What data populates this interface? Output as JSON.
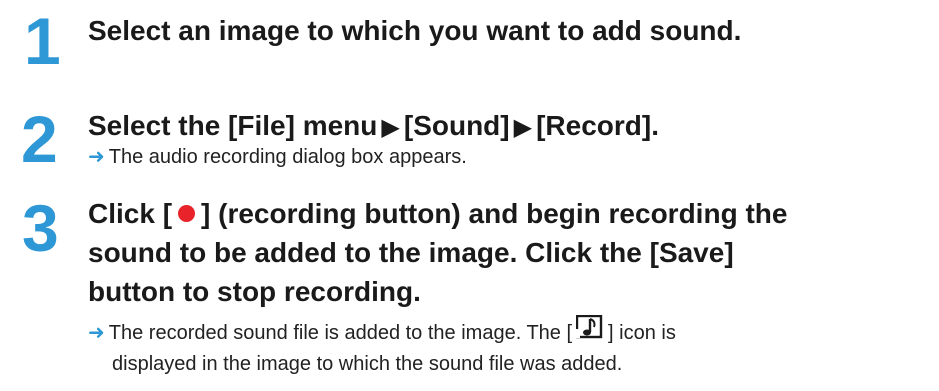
{
  "steps": [
    {
      "number": "1",
      "title": "Select an image to which you want to add sound."
    },
    {
      "number": "2",
      "title_parts": [
        "Select the [File] menu",
        "[Sound]",
        "[Record]."
      ],
      "result": "The audio recording dialog box appears."
    },
    {
      "number": "3",
      "title_line1_a": "Click [",
      "title_line1_b": "] (recording button) and begin recording the",
      "title_line2": "sound to be added to the image. Click the [Save]",
      "title_line3": "button to stop recording.",
      "result_line1_a": "The recorded sound file is added to the image. The [",
      "result_line1_b": "] icon is",
      "result_line2": "displayed in the image to which the sound file was added."
    }
  ],
  "icons": {
    "arrow": "right-arrow-icon",
    "menu_separator": "right-triangle-icon",
    "record": "record-dot-icon",
    "sound_file": "sound-file-icon"
  },
  "colors": {
    "accent": "#2e98d6",
    "record_red": "#e8232a",
    "text": "#1a1a1a"
  }
}
